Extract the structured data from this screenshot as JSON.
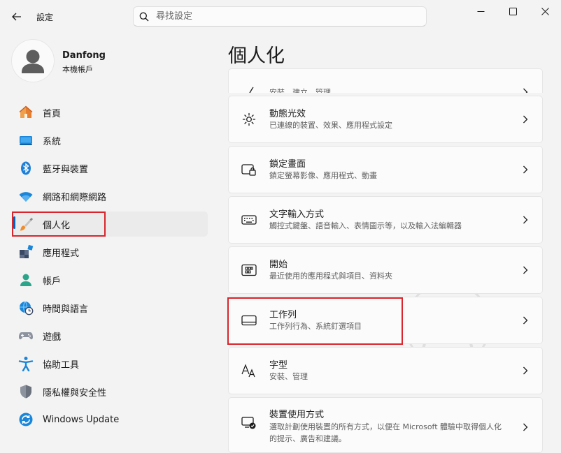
{
  "window": {
    "title": "設定"
  },
  "search": {
    "placeholder": "尋找設定"
  },
  "user": {
    "name": "Danfong",
    "account_type": "本機帳戶"
  },
  "nav": {
    "items": [
      {
        "label": "首頁",
        "icon": "home-icon"
      },
      {
        "label": "系統",
        "icon": "system-icon"
      },
      {
        "label": "藍牙與裝置",
        "icon": "bluetooth-icon"
      },
      {
        "label": "網路和網際網路",
        "icon": "wifi-icon"
      },
      {
        "label": "個人化",
        "icon": "brush-icon",
        "selected": true
      },
      {
        "label": "應用程式",
        "icon": "apps-icon"
      },
      {
        "label": "帳戶",
        "icon": "account-icon"
      },
      {
        "label": "時間與語言",
        "icon": "time-language-icon"
      },
      {
        "label": "遊戲",
        "icon": "gamepad-icon"
      },
      {
        "label": "協助工具",
        "icon": "accessibility-icon"
      },
      {
        "label": "隱私權與安全性",
        "icon": "shield-icon"
      },
      {
        "label": "Windows Update",
        "icon": "update-icon"
      }
    ]
  },
  "main": {
    "title": "個人化",
    "partial_card_subtitle": "安裝、建立，管理",
    "cards": [
      {
        "title": "動態光效",
        "subtitle": "已連線的裝置、效果、應用程式設定",
        "icon": "dynamic-lighting-icon"
      },
      {
        "title": "鎖定畫面",
        "subtitle": "鎖定螢幕影像、應用程式、動畫",
        "icon": "lock-screen-icon"
      },
      {
        "title": "文字輸入方式",
        "subtitle": "觸控式鍵盤、語音輸入、表情圖示等，以及輸入法編輯器",
        "icon": "keyboard-icon"
      },
      {
        "title": "開始",
        "subtitle": "最近使用的應用程式與項目、資料夾",
        "icon": "start-icon"
      },
      {
        "title": "工作列",
        "subtitle": "工作列行為、系統釘選項目",
        "icon": "taskbar-icon"
      },
      {
        "title": "字型",
        "subtitle": "安裝、管理",
        "icon": "fonts-icon"
      },
      {
        "title": "裝置使用方式",
        "subtitle": "選取計劃使用裝置的所有方式，以便在 Microsoft 體驗中取得個人化的提示、廣告和建議。",
        "icon": "device-usage-icon"
      }
    ]
  },
  "colors": {
    "accent": "#0067c0",
    "highlight_box": "#d9252b",
    "background": "#f3f3f3",
    "card": "#fbfbfb"
  }
}
